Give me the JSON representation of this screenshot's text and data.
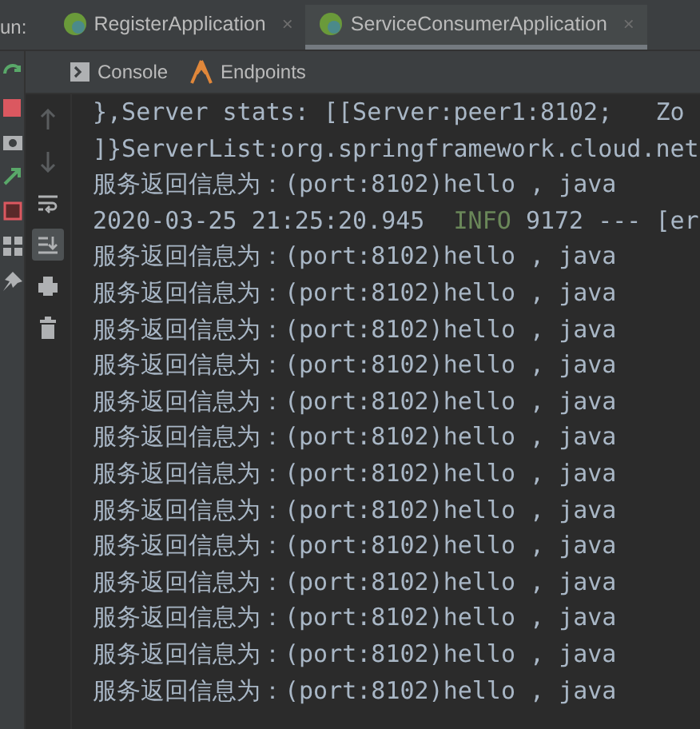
{
  "run_bar": {
    "label": "un:",
    "tabs": [
      {
        "title": "RegisterApplication",
        "close": "×",
        "selected": false
      },
      {
        "title": "ServiceConsumerApplication",
        "close": "×",
        "selected": true
      }
    ]
  },
  "console_tabs": [
    {
      "label": "Console",
      "kind": "console"
    },
    {
      "label": "Endpoints",
      "kind": "endpoints"
    }
  ],
  "side_tools": [
    {
      "kind": "up",
      "disabled": true
    },
    {
      "kind": "down",
      "disabled": true
    },
    {
      "kind": "wrap",
      "selected": false
    },
    {
      "kind": "scroll-end",
      "selected": true
    },
    {
      "kind": "print",
      "selected": false
    },
    {
      "kind": "trash",
      "selected": false
    }
  ],
  "console_lines": [
    {
      "kind": "plain",
      "text": "},Server stats: [[Server:peer1:8102;   Zo"
    },
    {
      "kind": "plain",
      "text": "]}ServerList:org.springframework.cloud.net"
    },
    {
      "kind": "plain",
      "text": "服务返回信息为：(port:8102)hello , java"
    },
    {
      "kind": "log",
      "timestamp": "2020-03-25 21:25:20.945",
      "level": "INFO",
      "rest": "9172 --- [er"
    },
    {
      "kind": "plain",
      "text": "服务返回信息为：(port:8102)hello , java"
    },
    {
      "kind": "plain",
      "text": "服务返回信息为：(port:8102)hello , java"
    },
    {
      "kind": "plain",
      "text": "服务返回信息为：(port:8102)hello , java"
    },
    {
      "kind": "plain",
      "text": "服务返回信息为：(port:8102)hello , java"
    },
    {
      "kind": "plain",
      "text": "服务返回信息为：(port:8102)hello , java"
    },
    {
      "kind": "plain",
      "text": "服务返回信息为：(port:8102)hello , java"
    },
    {
      "kind": "plain",
      "text": "服务返回信息为：(port:8102)hello , java"
    },
    {
      "kind": "plain",
      "text": "服务返回信息为：(port:8102)hello , java"
    },
    {
      "kind": "plain",
      "text": "服务返回信息为：(port:8102)hello , java"
    },
    {
      "kind": "plain",
      "text": "服务返回信息为：(port:8102)hello , java"
    },
    {
      "kind": "plain",
      "text": "服务返回信息为：(port:8102)hello , java"
    },
    {
      "kind": "plain",
      "text": "服务返回信息为：(port:8102)hello , java"
    },
    {
      "kind": "plain",
      "text": "服务返回信息为：(port:8102)hello , java"
    }
  ]
}
